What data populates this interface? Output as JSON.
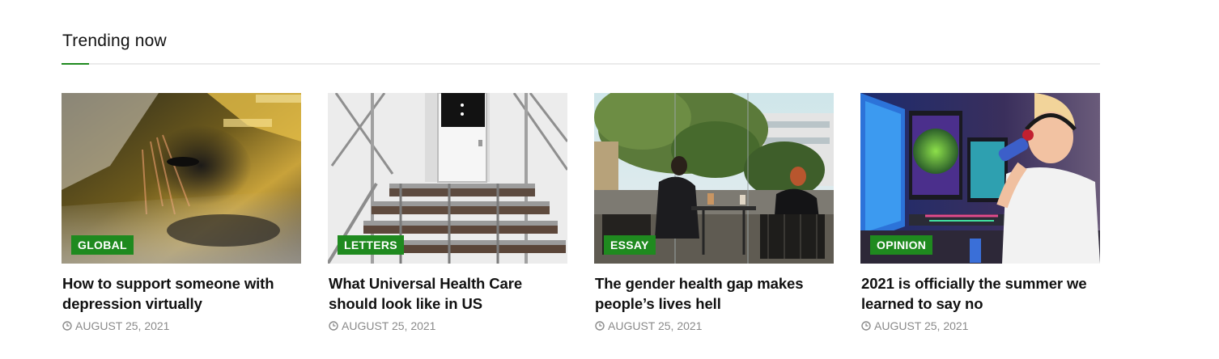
{
  "section": {
    "title": "Trending now"
  },
  "colors": {
    "accent": "#1f8a1f",
    "meta": "#8a8a8a",
    "title": "#111111"
  },
  "cards": [
    {
      "category": "GLOBAL",
      "title": "How to support someone with depression virtually",
      "date": "AUGUST 25, 2021",
      "image_icon": "blurred-person-car-lights-image"
    },
    {
      "category": "LETTERS",
      "title": "What Universal Health Care should look like in US",
      "date": "AUGUST 25, 2021",
      "image_icon": "metal-stairs-door-image"
    },
    {
      "category": "ESSAY",
      "title": "The gender health gap makes people’s lives hell",
      "date": "AUGUST 25, 2021",
      "image_icon": "cafe-terrace-women-image"
    },
    {
      "category": "OPINION",
      "title": "2021 is officially the summer we learned to say no",
      "date": "AUGUST 25, 2021",
      "image_icon": "gamer-drinking-image"
    }
  ]
}
